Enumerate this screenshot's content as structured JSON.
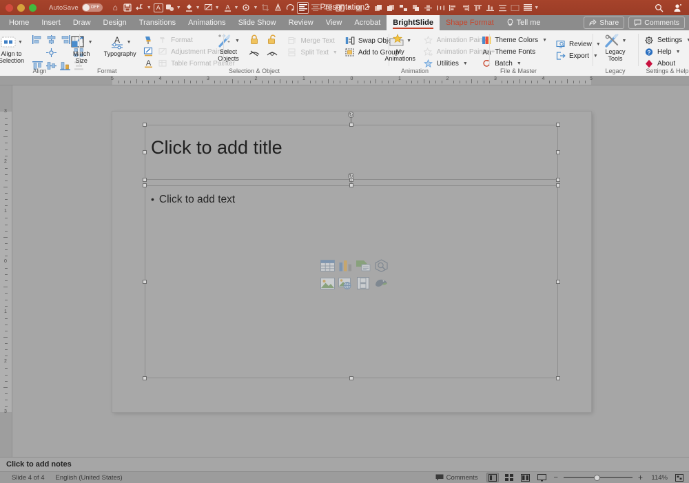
{
  "titlebar": {
    "autosave_label": "AutoSave",
    "autosave_state": "OFF",
    "document_title": "Presentation2",
    "quick_icons": [
      "home-icon",
      "save-icon",
      "undo-icon",
      "redo-caret",
      "text-box-icon",
      "shape-fill-icon",
      "fill-color-icon",
      "draw-pen-icon",
      "font-color-icon",
      "effects-icon",
      "crop-icon",
      "flip-icon",
      "rotate-icon",
      "align-left-icon",
      "align-center-icon",
      "align-right-icon",
      "columns-icon",
      "paste-icon",
      "arrange-front-icon",
      "arrange-back-icon",
      "group-icon",
      "ungroup-icon",
      "align-v-center-icon",
      "distribute-h-icon",
      "align-l-icon",
      "align-r-icon",
      "align-top-icon",
      "align-bottom-icon",
      "distribute-v-icon",
      "align-middle-icon",
      "reading-icon",
      "list-icon",
      "more-caret"
    ],
    "search_icon": "search-icon",
    "account_icon": "account-icon"
  },
  "tabs": [
    {
      "label": "Home",
      "state": "normal"
    },
    {
      "label": "Insert",
      "state": "normal"
    },
    {
      "label": "Draw",
      "state": "normal"
    },
    {
      "label": "Design",
      "state": "normal"
    },
    {
      "label": "Transitions",
      "state": "normal"
    },
    {
      "label": "Animations",
      "state": "normal"
    },
    {
      "label": "Slide Show",
      "state": "normal"
    },
    {
      "label": "Review",
      "state": "normal"
    },
    {
      "label": "View",
      "state": "normal"
    },
    {
      "label": "Acrobat",
      "state": "normal"
    },
    {
      "label": "BrightSlide",
      "state": "active"
    },
    {
      "label": "Shape Format",
      "state": "accent"
    }
  ],
  "tellme": {
    "label": "Tell me",
    "icon": "lightbulb-icon"
  },
  "tabright": {
    "share_label": "Share",
    "share_icon": "share-icon",
    "comments_label": "Comments",
    "comments_icon": "comment-icon"
  },
  "ribbon": {
    "groups": [
      {
        "name": "Align",
        "label": "Align",
        "big": {
          "label": "Align to\nSelection",
          "label_l1": "Align to",
          "label_l2": "Selection",
          "icon": "align-to-selection-icon",
          "has_caret": true
        },
        "grid_icons": [
          {
            "name": "align-left-icon",
            "disabled": false
          },
          {
            "name": "align-center-h-icon",
            "disabled": false
          },
          {
            "name": "align-right-icon",
            "disabled": false
          },
          {
            "name": "distribute-h-icon",
            "disabled": true
          },
          {
            "name": "blank",
            "disabled": true
          },
          {
            "name": "align-center-point-icon",
            "disabled": false
          },
          {
            "name": "blank",
            "disabled": true
          },
          {
            "name": "grid-arrange-icon",
            "disabled": false
          },
          {
            "name": "align-top-icon",
            "disabled": false
          },
          {
            "name": "align-middle-icon",
            "disabled": false
          },
          {
            "name": "align-bottom-icon",
            "disabled": false
          },
          {
            "name": "distribute-v-icon",
            "disabled": true
          }
        ]
      },
      {
        "name": "Format",
        "label": "Format",
        "buttons": [
          {
            "label_l1": "Match",
            "label_l2": "Size",
            "icon": "match-size-icon",
            "has_caret": true
          },
          {
            "label_l1": "Typography",
            "label_l2": "",
            "icon": "typography-icon",
            "has_caret": true
          }
        ],
        "menu": [
          {
            "label": "Format",
            "icon": "format-painter-icon",
            "disabled": true
          },
          {
            "label": "Adjustment Painter",
            "icon": "adjustment-painter-icon",
            "disabled": true
          },
          {
            "label": "Table Format Painter",
            "icon": "table-format-painter-icon",
            "disabled": true
          }
        ],
        "left_icons": [
          "format-brush-icon",
          "adjustment-pen-icon",
          "font-a-icon"
        ]
      },
      {
        "name": "Selection & Object",
        "label": "Selection & Object",
        "big": {
          "label_l1": "Select",
          "label_l2": "Objects",
          "icon": "select-objects-wand-icon",
          "has_caret": true
        },
        "lock_icons": [
          "lock-closed-icon",
          "lock-open-icon"
        ],
        "eye_icons": [
          "hide-icon",
          "show-icon"
        ],
        "menu": [
          {
            "label": "Merge Text",
            "icon": "merge-text-icon",
            "disabled": true
          },
          {
            "label": "Split Text",
            "icon": "split-text-icon",
            "disabled": true,
            "has_caret": true
          },
          {
            "label": "Swap Objects",
            "icon": "swap-objects-icon",
            "disabled": false
          },
          {
            "label": "Add to Group",
            "icon": "add-to-group-icon",
            "disabled": false
          }
        ]
      },
      {
        "name": "Animation",
        "label": "Animation",
        "big": {
          "label_l1": "My",
          "label_l2": "Animations",
          "icon": "my-animations-star-icon",
          "has_caret": true
        },
        "menu": [
          {
            "label": "Animation Painter",
            "icon": "animation-painter-icon",
            "disabled": true
          },
          {
            "label": "Animation Painter+",
            "icon": "animation-painter-plus-icon",
            "disabled": true
          },
          {
            "label": "Utilities",
            "icon": "utilities-star-icon",
            "disabled": false,
            "has_caret": true
          }
        ]
      },
      {
        "name": "File & Master",
        "label": "File & Master",
        "menu_left": [
          {
            "label": "Theme Colors",
            "icon": "theme-colors-icon",
            "has_caret": true
          },
          {
            "label": "Theme Fonts",
            "icon": "theme-fonts-aa-icon",
            "has_caret": false
          },
          {
            "label": "Batch",
            "icon": "batch-refresh-icon",
            "has_caret": true
          }
        ],
        "menu_right": [
          {
            "label": "Review",
            "icon": "review-screen-icon",
            "has_caret": true
          },
          {
            "label": "Export",
            "icon": "export-icon",
            "has_caret": true
          }
        ]
      },
      {
        "name": "Legacy",
        "label": "Legacy",
        "big": {
          "label_l1": "Legacy",
          "label_l2": "Tools",
          "icon": "legacy-tools-icon",
          "has_caret": true
        }
      },
      {
        "name": "Settings & Help",
        "label": "Settings & Help",
        "menu": [
          {
            "label": "Settings",
            "icon": "gear-icon",
            "has_caret": true
          },
          {
            "label": "Help",
            "icon": "help-circle-icon",
            "has_caret": true
          },
          {
            "label": "About",
            "icon": "about-diamond-icon",
            "has_caret": false
          }
        ]
      }
    ]
  },
  "rulers": {
    "horizontal_ticks": [
      "5",
      "4",
      "3",
      "2",
      "1",
      "0",
      "1",
      "2",
      "3",
      "4",
      "5"
    ],
    "vertical_ticks": [
      "3",
      "2",
      "1",
      "0",
      "1",
      "2",
      "3"
    ],
    "units": "inches"
  },
  "slide": {
    "title_placeholder": "Click to add title",
    "body_placeholder": "Click to add text",
    "body_bullet": "•",
    "content_icons": [
      "insert-table-icon",
      "insert-chart-icon",
      "insert-smartart-icon",
      "insert-3d-model-icon",
      "insert-picture-icon",
      "insert-online-picture-icon",
      "insert-video-icon",
      "insert-stock-images-icon"
    ],
    "selected": true
  },
  "notes": {
    "placeholder": "Click to add notes"
  },
  "status": {
    "slide_counter": "Slide 4 of 4",
    "language": "English (United States)",
    "comments_label": "Comments",
    "comments_icon": "comment-icon",
    "views": [
      {
        "name": "normal-view-button",
        "icon": "normal-view-icon",
        "active": true
      },
      {
        "name": "slide-sorter-button",
        "icon": "slide-sorter-icon",
        "active": false
      },
      {
        "name": "reading-view-button",
        "icon": "reading-view-icon",
        "active": false
      },
      {
        "name": "slideshow-button",
        "icon": "slideshow-icon",
        "active": false
      }
    ],
    "zoom_out": "−",
    "zoom_in": "+",
    "zoom_level": "114%",
    "fit_icon": "fit-to-window-icon"
  },
  "colors": {
    "titlebar": "#a23f28",
    "accent": "#c8442a",
    "tabbar": "#8c8c8c",
    "ribbon": "#f2f2f2",
    "canvas": "#a6a6a6",
    "slide": "#a8a8a8"
  }
}
